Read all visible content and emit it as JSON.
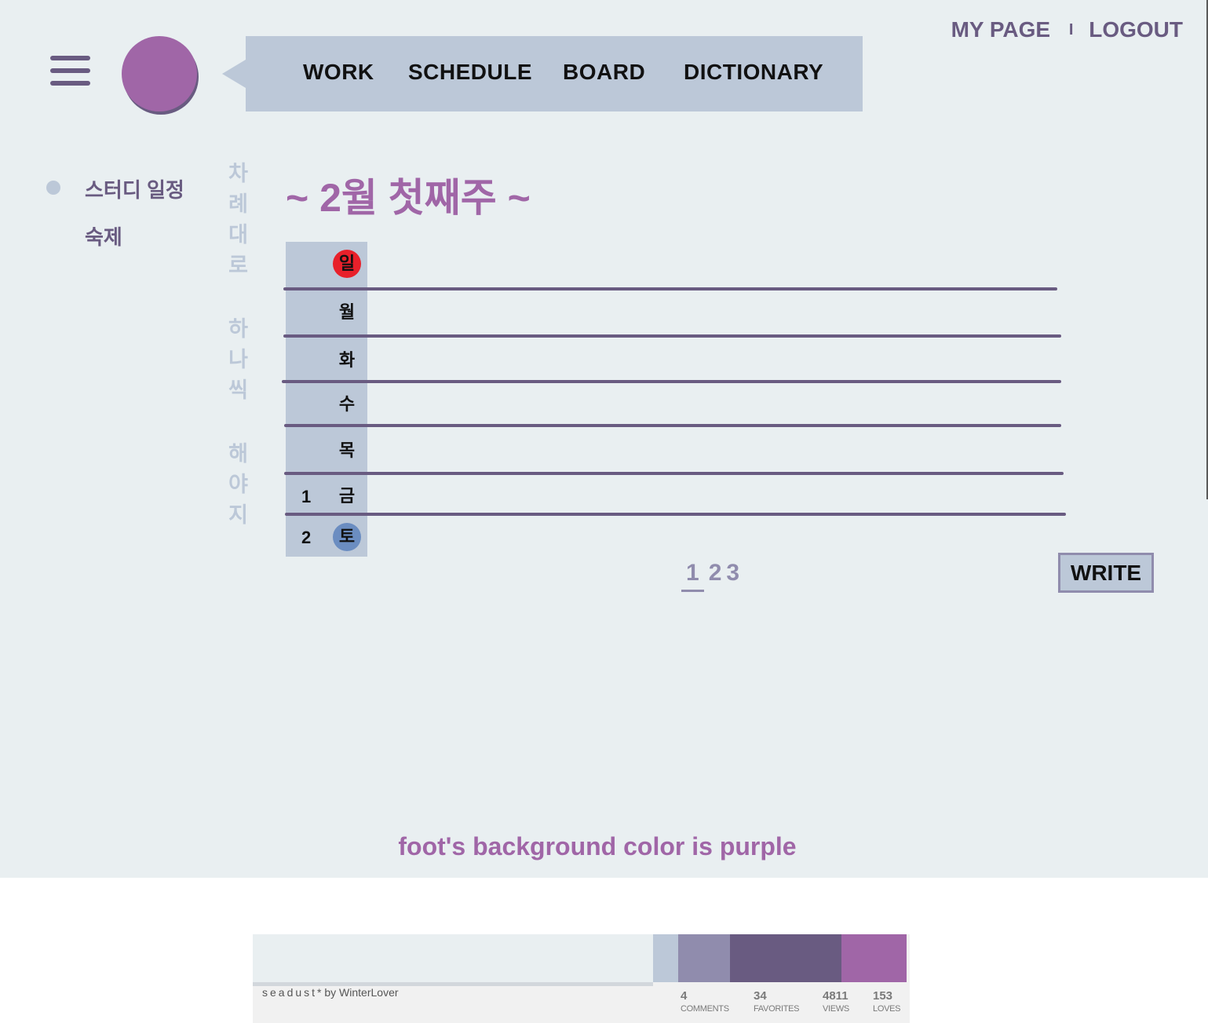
{
  "header": {
    "nav": [
      "WORK",
      "SCHEDULE",
      "BOARD",
      "DICTIONARY"
    ],
    "my_page": "MY PAGE",
    "separator": "I",
    "logout": "LOGOUT"
  },
  "sidebar": {
    "items": [
      "스터디 일정",
      "숙제"
    ],
    "vertical_text": "차례대로 하나씩 해야지"
  },
  "main": {
    "title": "~ 2월 첫째주 ~",
    "days": [
      "일",
      "월",
      "화",
      "수",
      "목",
      "금",
      "토"
    ],
    "dates": [
      "1",
      "2"
    ],
    "pages": [
      "1",
      "2",
      "3"
    ],
    "write_label": "WRITE"
  },
  "footer_note": "foot's background color is purple",
  "palette": {
    "name": "seadust",
    "suffix": "* by WinterLover",
    "colors": [
      "#e9eff1",
      "#bcc8d8",
      "#908cad",
      "#695b81",
      "#a066a7"
    ],
    "stats": [
      {
        "value": "4",
        "label": "COMMENTS"
      },
      {
        "value": "34",
        "label": "FAVORITES"
      },
      {
        "value": "4811",
        "label": "VIEWS"
      },
      {
        "value": "153",
        "label": "LOVES"
      }
    ]
  },
  "colors": {
    "background": "#e9eff1",
    "light": "#bcc8d8",
    "muted": "#908cad",
    "dark": "#695b81",
    "accent": "#a066a7",
    "sunday": "#e8202a",
    "saturday": "#6b8dc1"
  }
}
